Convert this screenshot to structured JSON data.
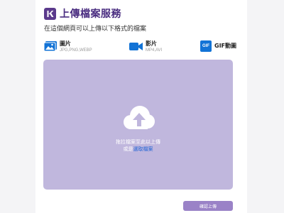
{
  "header": {
    "logo_letter": "K",
    "title": "上傳檔案服務"
  },
  "subtitle": "在這個網頁可以上傳以下格式的檔案",
  "file_types": [
    {
      "icon": "image-icon",
      "name": "圖片",
      "ext": "JPG,PNG,WEBP"
    },
    {
      "icon": "video-camera-icon",
      "name": "影片",
      "ext": "MP4,AVI"
    },
    {
      "icon": "gif-icon",
      "badge": "GIF",
      "name": "GIF動圖"
    }
  ],
  "dropzone": {
    "icon": "cloud-upload-icon",
    "line1": "拖拉檔案至此以上傳",
    "line2_prefix": "或是",
    "link": "選取檔案"
  },
  "confirm_button": "確認上傳",
  "colors": {
    "brand": "#5b3a8c",
    "dropzone": "#c0b7dd",
    "button": "#9a82c7",
    "link": "#1e63d6",
    "icon_blue": "#1273d6"
  }
}
